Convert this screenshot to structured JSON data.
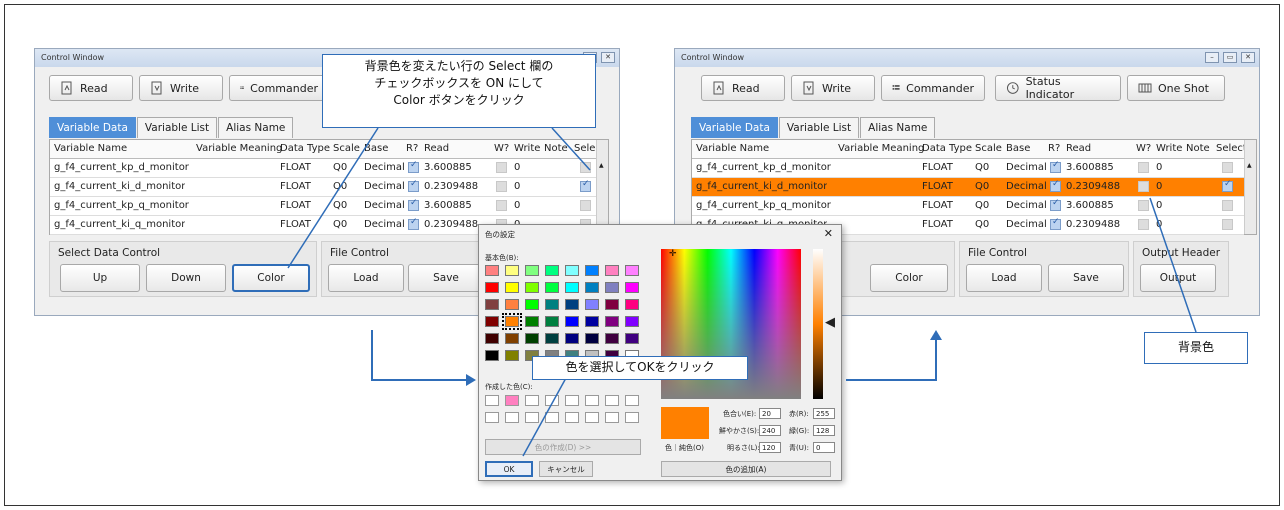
{
  "left_window": {
    "title": "Control Window",
    "toolbar": {
      "read": "Read",
      "write": "Write",
      "commander": "Commander"
    },
    "tabs": [
      "Variable Data",
      "Variable List",
      "Alias Name"
    ],
    "headers": [
      "Variable Name",
      "Variable Meaning",
      "Data Type",
      "Scale",
      "Base",
      "R?",
      "Read",
      "W?",
      "Write",
      "Note",
      "Select"
    ],
    "rows": [
      {
        "name": "g_f4_current_kp_d_monitor",
        "type": "FLOAT",
        "scale": "Q0",
        "base": "Decimal",
        "read": "3.600885",
        "write": "0",
        "select": false
      },
      {
        "name": "g_f4_current_ki_d_monitor",
        "type": "FLOAT",
        "scale": "Q0",
        "base": "Decimal",
        "read": "0.2309488",
        "write": "0",
        "select": true
      },
      {
        "name": "g_f4_current_kp_q_monitor",
        "type": "FLOAT",
        "scale": "Q0",
        "base": "Decimal",
        "read": "3.600885",
        "write": "0",
        "select": false
      },
      {
        "name": "g_f4_current_ki_q_monitor",
        "type": "FLOAT",
        "scale": "Q0",
        "base": "Decimal",
        "read": "0.2309488",
        "write": "0",
        "select": false
      }
    ],
    "select_group": {
      "label": "Select Data Control",
      "up": "Up",
      "down": "Down",
      "color": "Color"
    },
    "file_group": {
      "label": "File Control",
      "load": "Load",
      "save": "Save"
    }
  },
  "right_window": {
    "title": "Control Window",
    "toolbar": {
      "read": "Read",
      "write": "Write",
      "commander": "Commander",
      "status": "Status Indicator",
      "oneshot": "One Shot"
    },
    "tabs": [
      "Variable Data",
      "Variable List",
      "Alias Name"
    ],
    "headers": [
      "Variable Name",
      "Variable Meaning",
      "Data Type",
      "Scale",
      "Base",
      "R?",
      "Read",
      "W?",
      "Write",
      "Note",
      "Select"
    ],
    "rows": [
      {
        "name": "g_f4_current_kp_d_monitor",
        "type": "FLOAT",
        "scale": "Q0",
        "base": "Decimal",
        "read": "3.600885",
        "write": "0",
        "select": false
      },
      {
        "name": "g_f4_current_ki_d_monitor",
        "type": "FLOAT",
        "scale": "Q0",
        "base": "Decimal",
        "read": "0.2309488",
        "write": "0",
        "select": true
      },
      {
        "name": "g_f4_current_kp_q_monitor",
        "type": "FLOAT",
        "scale": "Q0",
        "base": "Decimal",
        "read": "3.600885",
        "write": "0",
        "select": false
      },
      {
        "name": "g_f4_current_ki_q_monitor",
        "type": "FLOAT",
        "scale": "Q0",
        "base": "Decimal",
        "read": "0.2309488",
        "write": "0",
        "select": false
      }
    ],
    "highlight_color": "#ff8000",
    "select_group": {
      "color": "Color"
    },
    "file_group": {
      "label": "File Control",
      "load": "Load",
      "save": "Save"
    },
    "output_group": {
      "label": "Output Header",
      "output": "Output"
    }
  },
  "callouts": {
    "top": [
      "背景色を変えたい行の Select 欄の",
      "チェックボックスを ON にして",
      "Color ボタンをクリック"
    ],
    "middle": "色を選択してOKをクリック",
    "right": "背景色"
  },
  "color_dialog": {
    "title": "色の設定",
    "basic_label": "基本色(B):",
    "custom_label": "作成した色(C):",
    "define_button": "色の作成(D) >>",
    "ok": "OK",
    "cancel": "キャンセル",
    "preview_label": "色｜純色(O)",
    "add_button": "色の追加(A)",
    "hue_label": "色合い(E):",
    "hue": "20",
    "sat_label": "鮮やかさ(S):",
    "sat": "240",
    "lum_label": "明るさ(L):",
    "lum": "120",
    "red_label": "赤(R):",
    "red": "255",
    "green_label": "緑(G):",
    "green": "128",
    "blue_label": "青(U):",
    "blue": "0",
    "selected_color": "#ff8000",
    "basic_colors": [
      [
        "#ff8080",
        "#ffff80",
        "#80ff80",
        "#00ff80",
        "#80ffff",
        "#0080ff",
        "#ff80c0",
        "#ff80ff"
      ],
      [
        "#ff0000",
        "#ffff00",
        "#80ff00",
        "#00ff40",
        "#00ffff",
        "#0080c0",
        "#8080c0",
        "#ff00ff"
      ],
      [
        "#804040",
        "#ff8040",
        "#00ff00",
        "#008080",
        "#004080",
        "#8080ff",
        "#800040",
        "#ff0080"
      ],
      [
        "#800000",
        "#ff8000",
        "#008000",
        "#008040",
        "#0000ff",
        "#0000a0",
        "#800080",
        "#8000ff"
      ],
      [
        "#400000",
        "#804000",
        "#004000",
        "#004040",
        "#000080",
        "#000040",
        "#400040",
        "#400080"
      ],
      [
        "#000000",
        "#808000",
        "#808040",
        "#808080",
        "#408080",
        "#c0c0c0",
        "#400040",
        "#ffffff"
      ]
    ],
    "custom_colors": [
      "#ffffff",
      "#ff80c0",
      "#ffffff",
      "#ffffff",
      "#ffffff",
      "#ffffff",
      "#ffffff",
      "#ffffff",
      "#ffffff",
      "#ffffff",
      "#ffffff",
      "#ffffff",
      "#ffffff",
      "#ffffff",
      "#ffffff",
      "#ffffff"
    ]
  }
}
